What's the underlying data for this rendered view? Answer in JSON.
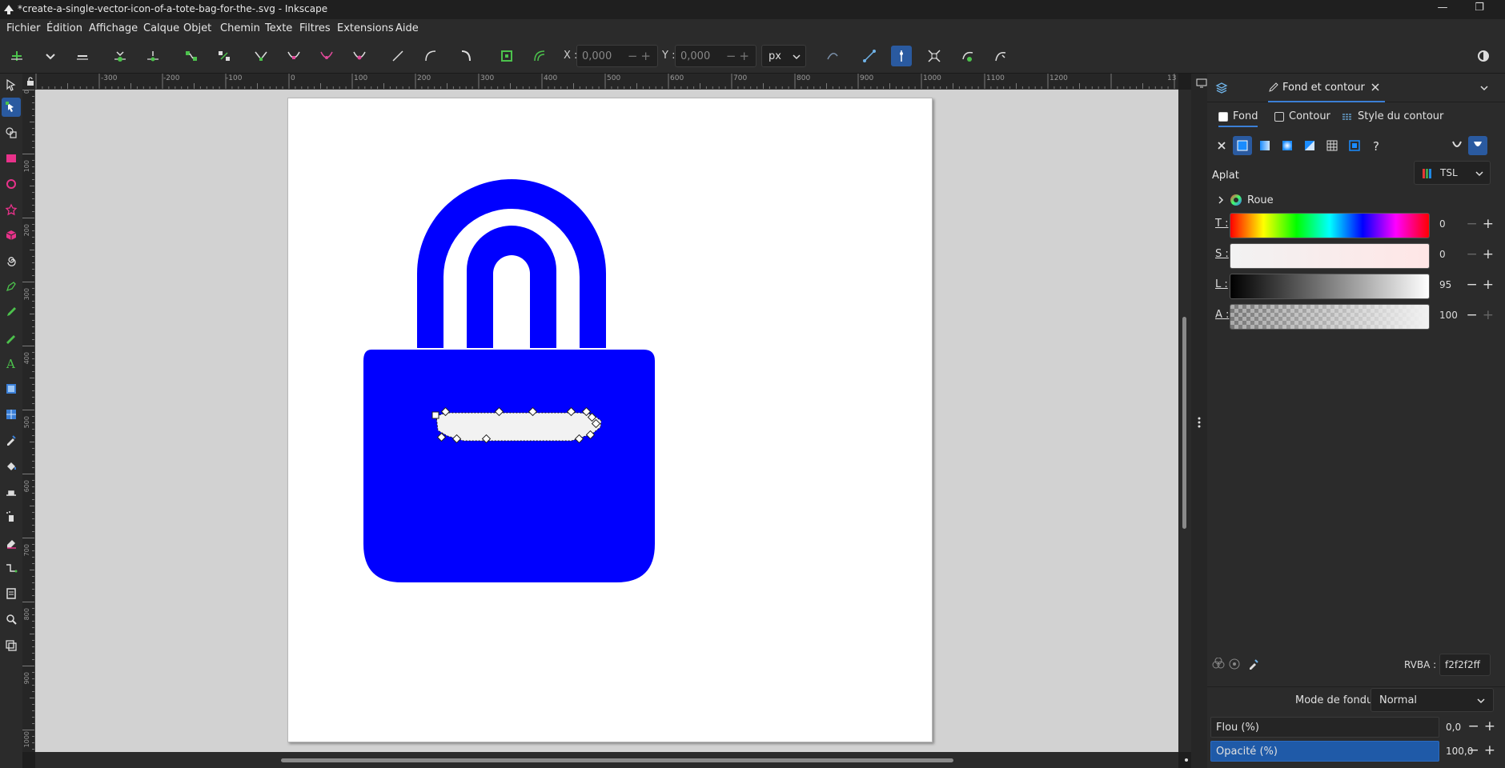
{
  "window": {
    "title": "*create-a-single-vector-icon-of-a-tote-bag-for-the-.svg - Inkscape"
  },
  "menu": [
    "Fichier",
    "Édition",
    "Affichage",
    "Calque",
    "Objet",
    "Chemin",
    "Texte",
    "Filtres",
    "Extensions",
    "Aide"
  ],
  "toolbar": {
    "x_label": "X :",
    "x_value": "0,000",
    "y_label": "Y :",
    "y_value": "0,000",
    "unit": "px"
  },
  "rulers": {
    "top": [
      "-300",
      "-200",
      "-100",
      "0",
      "100",
      "200",
      "300",
      "400",
      "500",
      "600",
      "700",
      "800",
      "900",
      "1000",
      "1100",
      "1200",
      "13"
    ],
    "left": [
      "0",
      "100",
      "200",
      "300",
      "400",
      "500",
      "600",
      "700",
      "800",
      "900",
      "1000"
    ]
  },
  "panel": {
    "tab_title": "Fond et contour",
    "subtabs": [
      "Fond",
      "Contour",
      "Style du contour"
    ],
    "flat_label": "Aplat",
    "color_mode": "TSL",
    "wheel_label": "Roue",
    "sliders": [
      {
        "label": "T :",
        "value": "0"
      },
      {
        "label": "S :",
        "value": "0"
      },
      {
        "label": "L :",
        "value": "95"
      },
      {
        "label": "A :",
        "value": "100"
      }
    ],
    "rgba_label": "RVBA :",
    "rgba_value": "f2f2f2ff",
    "blend_label": "Mode de fondu :",
    "blend_value": "Normal",
    "blur_label": "Flou (%)",
    "blur_value": "0,0",
    "opacity_label": "Opacité (%)",
    "opacity_value": "100,0"
  },
  "colors": {
    "bag": "#0000ff",
    "selected_fill": "#f2f2f2",
    "accent": "#2a5aa0"
  }
}
